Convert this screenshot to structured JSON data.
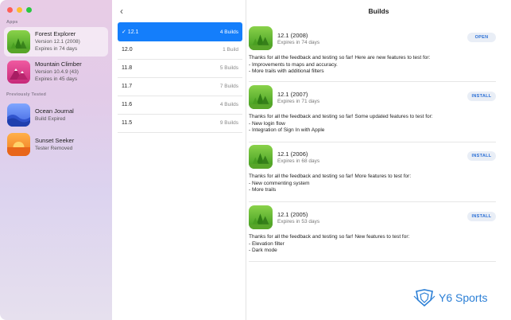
{
  "window": {
    "title": "Builds"
  },
  "sidebar": {
    "apps_label": "Apps",
    "previously_tested_label": "Previously Tested",
    "apps": [
      {
        "name": "Forest Explorer",
        "line1": "Version 12.1 (2008)",
        "line2": "Expires in 74 days",
        "icon": "forest-icon"
      },
      {
        "name": "Mountain Climber",
        "line1": "Version 10.4.9 (43)",
        "line2": "Expires in 45 days",
        "icon": "mountain-icon"
      }
    ],
    "previous": [
      {
        "name": "Ocean Journal",
        "line1": "Build Expired",
        "icon": "ocean-icon"
      },
      {
        "name": "Sunset Seeker",
        "line1": "Tester Removed",
        "icon": "sunset-icon"
      }
    ]
  },
  "versions": [
    {
      "label": "✓ 12.1",
      "count": "4 Builds",
      "selected": true
    },
    {
      "label": "12.0",
      "count": "1 Build"
    },
    {
      "label": "11.8",
      "count": "5 Builds"
    },
    {
      "label": "11.7",
      "count": "7 Builds"
    },
    {
      "label": "11.6",
      "count": "4 Builds"
    },
    {
      "label": "11.5",
      "count": "9 Builds"
    }
  ],
  "builds": [
    {
      "title": "12.1 (2008)",
      "expires": "Expires in 74 days",
      "action": "OPEN",
      "notes": [
        "Thanks for all the feedback and testing so far! Here are new features to test for:",
        "- Improvements to maps and accuracy.",
        "- More trails with additional filters"
      ]
    },
    {
      "title": "12.1 (2007)",
      "expires": "Expires in 71 days",
      "action": "INSTALL",
      "notes": [
        "Thanks for all the feedback and testing so far! Some updated features to test for:",
        "- New login flow",
        "- Integration of Sign In with Apple"
      ]
    },
    {
      "title": "12.1 (2006)",
      "expires": "Expires in 68 days",
      "action": "INSTALL",
      "notes": [
        "Thanks for all the feedback and testing so far! More features to test for:",
        "- New commenting system",
        "- More trails"
      ]
    },
    {
      "title": "12.1 (2005)",
      "expires": "Expires in 53 days",
      "action": "INSTALL",
      "notes": [
        "Thanks for all the feedback and testing so far! New features to test for:",
        "- Elevation filter",
        "- Dark mode"
      ]
    }
  ],
  "watermark": {
    "text": "Y6 Sports"
  }
}
